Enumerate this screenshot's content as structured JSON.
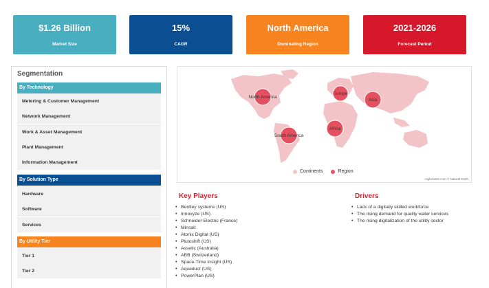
{
  "stats": [
    {
      "value": "$1.26 Billion",
      "label": "Market Size",
      "color": "#4aaec1"
    },
    {
      "value": "15%",
      "label": "CAGR",
      "color": "#0b4f92"
    },
    {
      "value": "North America",
      "label": "Dominating Region",
      "color": "#f7841f"
    },
    {
      "value": "2021-2026",
      "label": "Forecast Period",
      "color": "#d6182a"
    }
  ],
  "segmentation": {
    "title": "Segmentation",
    "groups": [
      {
        "header": "By Technology",
        "color": "#4aaec1",
        "items": [
          "Metering & Customer Management",
          "Network Management",
          "Work & Asset Management",
          "Plant Management",
          "Information Management"
        ]
      },
      {
        "header": "By Solution Type",
        "color": "#0b4f92",
        "items": [
          "Hardware",
          "Software",
          "Services"
        ]
      },
      {
        "header": "By Utility Tier",
        "color": "#f7841f",
        "items": [
          "Tier 1",
          "Tier 2"
        ]
      }
    ]
  },
  "map": {
    "regions": [
      "North America",
      "Europe",
      "Asia",
      "Africa",
      "South America"
    ],
    "legend": {
      "continents": "Continents",
      "region": "Region"
    },
    "credit": "Highcharts.com © Natural Earth",
    "colors": {
      "land": "#f2c3c7",
      "region": "#e4505f"
    }
  },
  "key_players": {
    "title": "Key Players",
    "items": [
      "Bentley systems (US)",
      "Innovyze (US)",
      "Schneider Electric (France)",
      "Minsait",
      "Atonix Digital (US)",
      "Plutoshift (US)",
      "Assetic (Australia)",
      "ABB (Switzerland)",
      "Space-Time Insight (US)",
      "Aqueduct (US)",
      "PowerPlan (US)"
    ]
  },
  "drivers": {
    "title": "Drivers",
    "items": [
      "Lack of a digitally skilled workforce",
      "The rising demand for quality water services",
      "The rising digitalization of the utility sector"
    ]
  }
}
